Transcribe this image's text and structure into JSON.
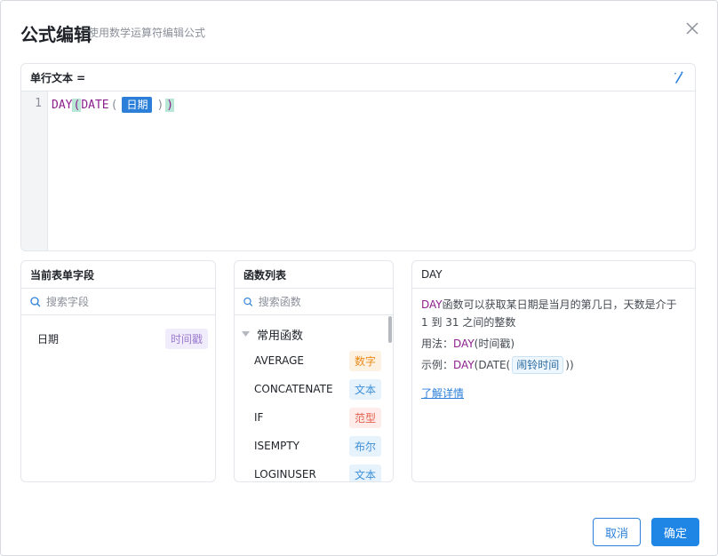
{
  "dialog": {
    "title": "公式编辑",
    "subtitle": "使用数学运算符编辑公式"
  },
  "editor": {
    "label": "单行文本 =",
    "line_number": "1",
    "formula": {
      "fn_day": "DAY",
      "paren_open": "(",
      "fn_date": "DATE",
      "paren_open_inner": "(",
      "field": "日期",
      "paren_close_inner": ")",
      "paren_close": ")"
    }
  },
  "fields_panel": {
    "title": "当前表单字段",
    "search_placeholder": "搜索字段",
    "items": [
      {
        "name": "日期",
        "type": "时间戳"
      }
    ]
  },
  "functions_panel": {
    "title": "函数列表",
    "search_placeholder": "搜索函数",
    "group": "常用函数",
    "items": [
      {
        "name": "AVERAGE",
        "type": "数字"
      },
      {
        "name": "CONCATENATE",
        "type": "文本"
      },
      {
        "name": "IF",
        "type": "范型"
      },
      {
        "name": "ISEMPTY",
        "type": "布尔"
      },
      {
        "name": "LOGINUSER",
        "type": "文本"
      }
    ]
  },
  "detail_panel": {
    "title": "DAY",
    "desc_fn": "DAY",
    "description": "函数可以获取某日期是当月的第几日，天数是介于 1 到 31 之间的整数",
    "usage_label": "用法：",
    "usage_fn": "DAY",
    "usage_args": "(时间戳)",
    "example_label": "示例：",
    "example_fn": "DAY",
    "example_inner": "(DATE(",
    "example_field": "闹铃时间",
    "example_close": "))",
    "learn_more": "了解详情"
  },
  "footer": {
    "cancel": "取消",
    "confirm": "确定"
  },
  "colors": {
    "primary": "#1f86e6",
    "function": "#8c1f8c",
    "field_chip": "#2b7fd9"
  }
}
